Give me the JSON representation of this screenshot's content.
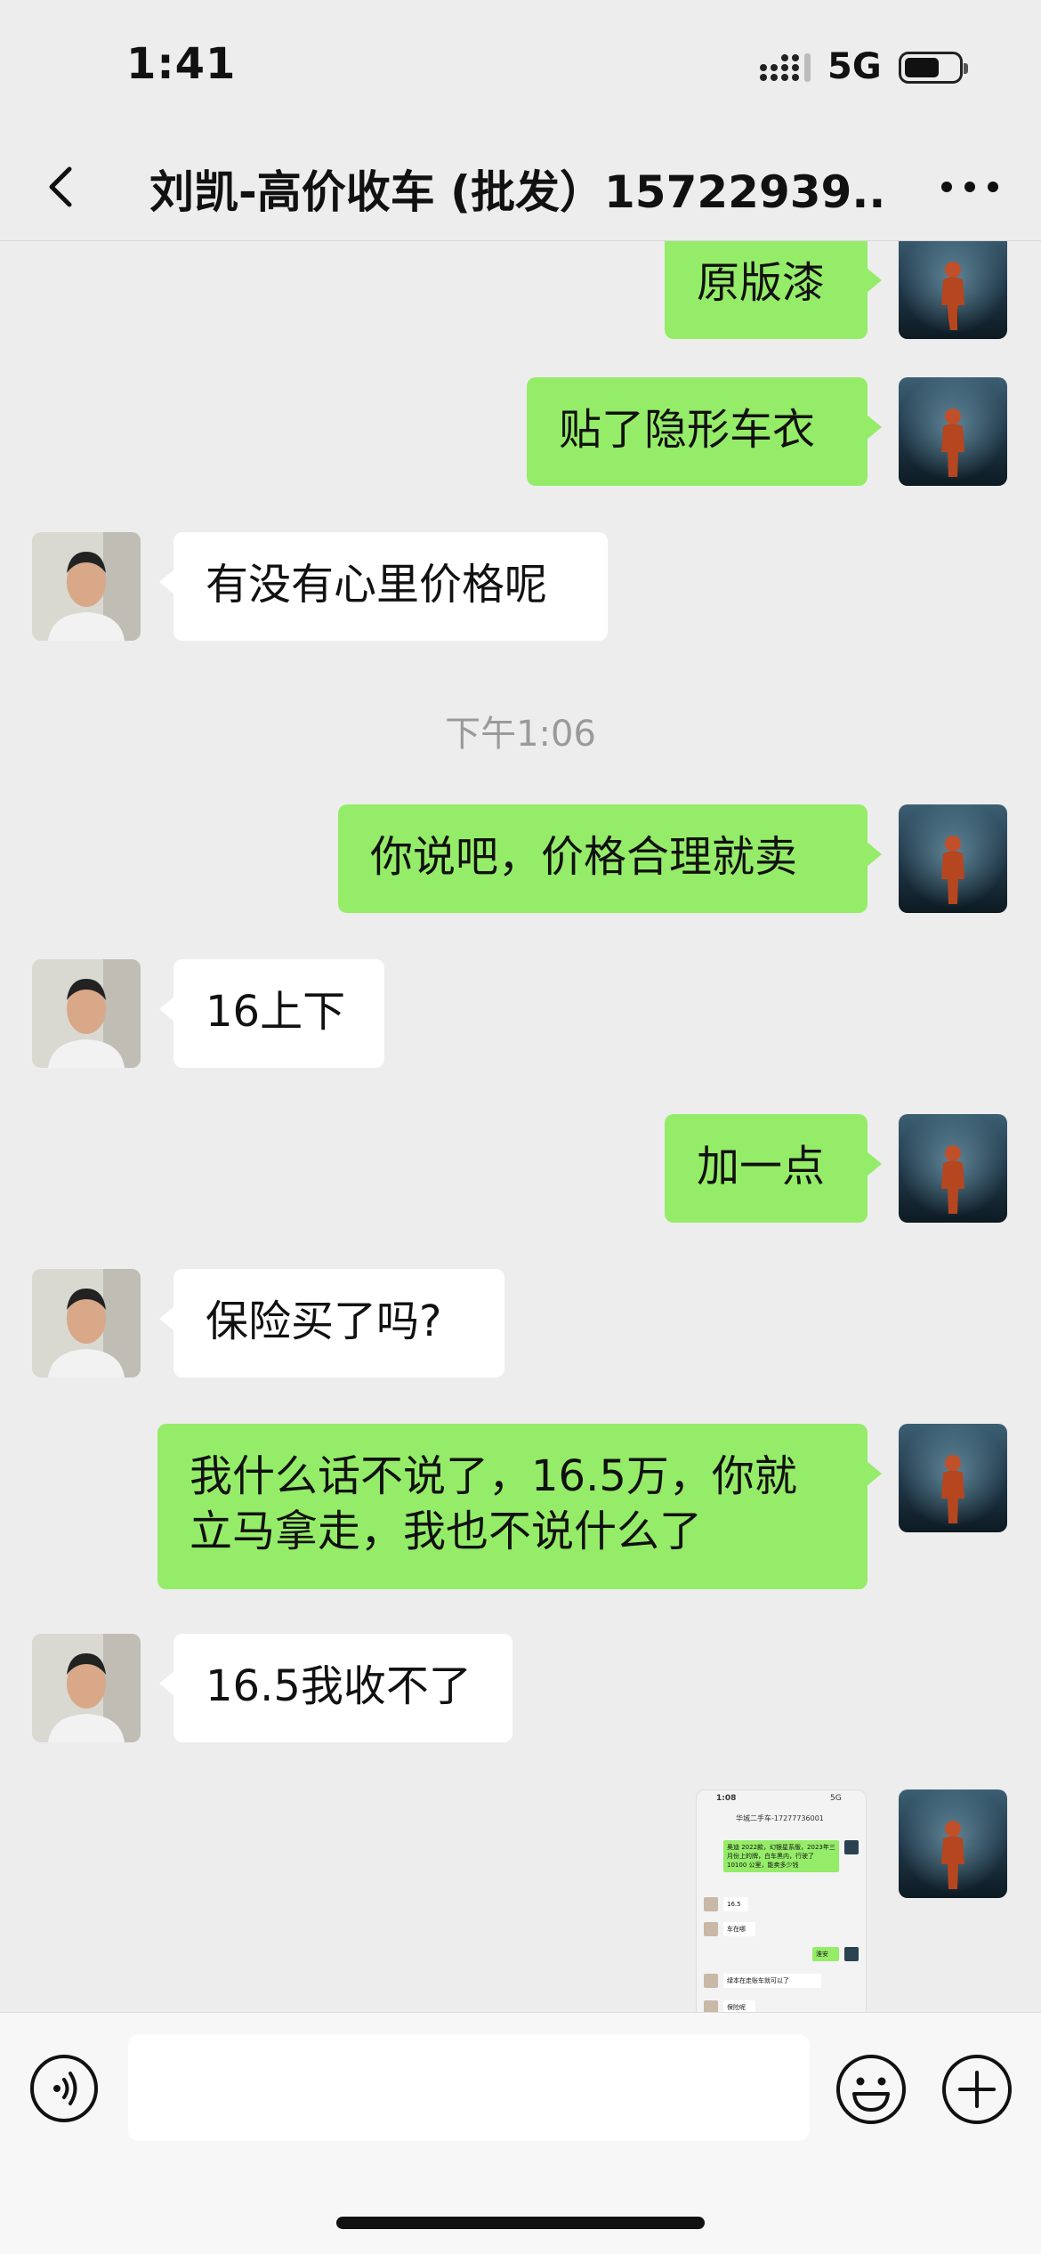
{
  "status_bar": {
    "time": "1:41",
    "network": "5G",
    "battery_level": 0.65
  },
  "nav": {
    "title": "刘凯-高价收车 (批发）15722939...",
    "back_icon": "chevron-left-icon",
    "more_icon": "more-dots-icon"
  },
  "messages": [
    {
      "from": "me",
      "text": "原版漆"
    },
    {
      "from": "me",
      "text": "贴了隐形车衣"
    },
    {
      "from": "them",
      "text": "有没有心里价格呢"
    },
    {
      "type": "timestamp",
      "text": "下午1:06"
    },
    {
      "from": "me",
      "text": "你说吧，价格合理就卖"
    },
    {
      "from": "them",
      "text": "16上下"
    },
    {
      "from": "me",
      "text": "加一点"
    },
    {
      "from": "them",
      "text": "保险买了吗?"
    },
    {
      "from": "me",
      "text": "我什么话不说了，16.5万，你就立马拿走，我也不说什么了"
    },
    {
      "from": "them",
      "text": "16.5我收不了"
    }
  ],
  "image_message": {
    "time": "1:08",
    "network": "5G",
    "title": "华城二手车-17277736001",
    "lines": [
      "奥迪 2022款，幻银星系版，2023年三月份上的牌，白车黑内，行驶了 10100 公里，能卖多少钱",
      "16.5",
      "车在哪",
      "淮安",
      "绿本在走账车就可以了",
      "保险呢"
    ]
  },
  "input_bar": {
    "voice_icon": "voice-icon",
    "emoji_icon": "emoji-icon",
    "plus_icon": "plus-icon",
    "placeholder": ""
  },
  "colors": {
    "sent_bubble": "#95ec69",
    "received_bubble": "#ffffff",
    "background": "#ededed"
  }
}
